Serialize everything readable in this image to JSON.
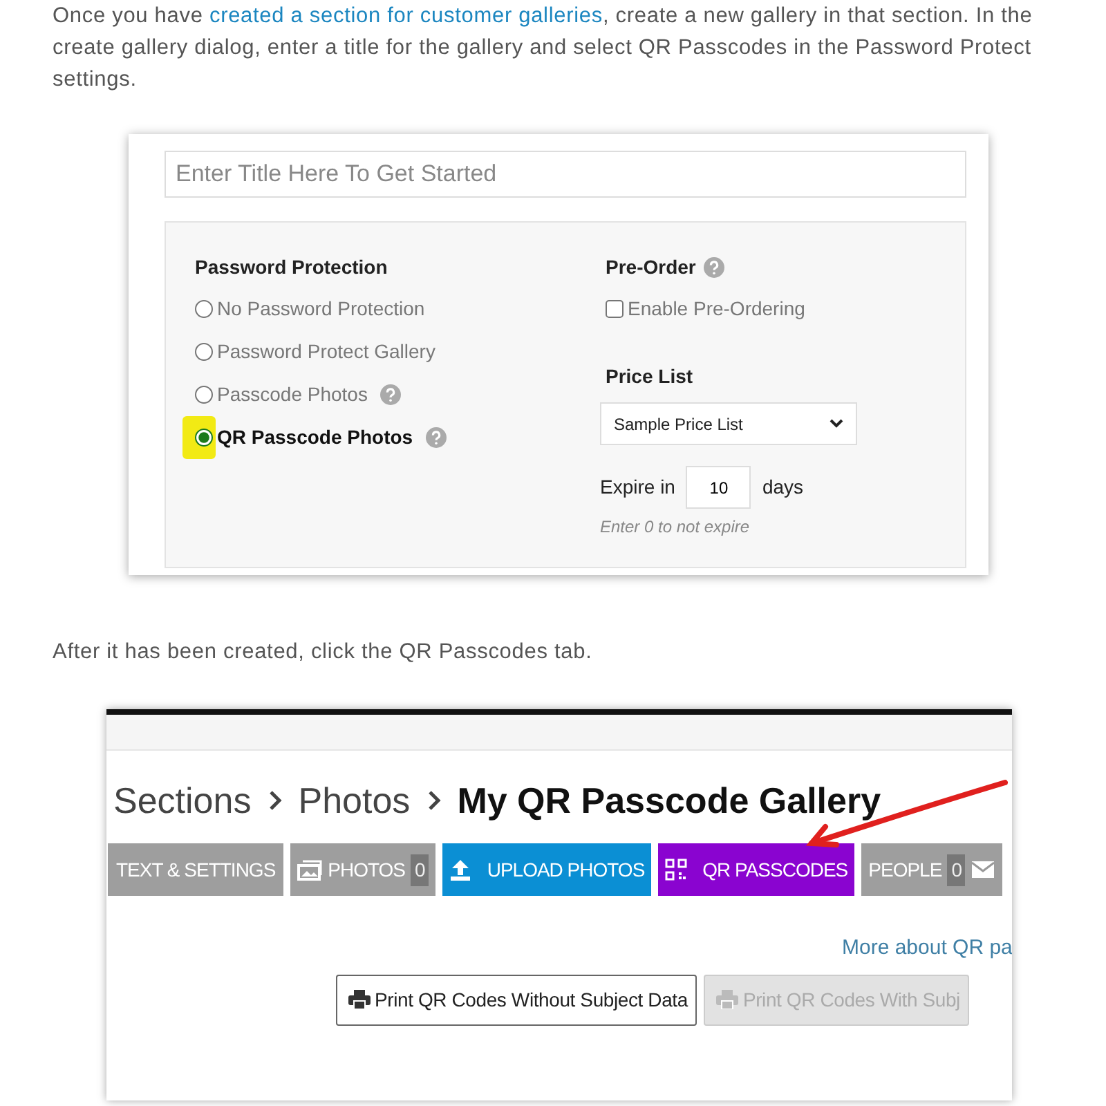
{
  "intro": {
    "before": "Once you have ",
    "link": "created a section for customer galleries",
    "after": ", create a new gallery in that section.  In the create gallery dialog, enter a title for the gallery and select QR Passcodes in the Password Protect settings."
  },
  "dialog": {
    "title_field": {
      "placeholder": "Enter Title Here To Get Started"
    },
    "password_protection": {
      "heading": "Password Protection",
      "options": [
        {
          "label": "No Password Protection",
          "selected": false,
          "help": false,
          "highlighted": false
        },
        {
          "label": "Password Protect Gallery",
          "selected": false,
          "help": false,
          "highlighted": false
        },
        {
          "label": "Passcode Photos",
          "selected": false,
          "help": true,
          "highlighted": false
        },
        {
          "label": "QR Passcode Photos",
          "selected": true,
          "help": true,
          "highlighted": true
        }
      ]
    },
    "preorder": {
      "heading": "Pre-Order",
      "checkbox": {
        "label": "Enable Pre-Ordering",
        "checked": false
      }
    },
    "price_list": {
      "heading": "Price List",
      "value": "Sample Price List"
    },
    "expire": {
      "label": "Expire in",
      "value": "10",
      "unit": "days",
      "hint": "Enter 0 to not expire"
    }
  },
  "step2": "After it has been created, click the QR Passcodes tab.",
  "gallery": {
    "breadcrumb": [
      {
        "label": "Sections",
        "current": false
      },
      {
        "label": "Photos",
        "current": false
      },
      {
        "label": "My QR Passcode Gallery",
        "current": true
      }
    ],
    "tabs": [
      {
        "label": "TEXT & SETTINGS",
        "kind": "plain",
        "color": "#9e9e9e"
      },
      {
        "label": "PHOTOS",
        "kind": "photos",
        "count": "0",
        "color": "#9e9e9e"
      },
      {
        "label": "UPLOAD PHOTOS",
        "kind": "upload",
        "color": "#0b8fd4"
      },
      {
        "label": "QR PASSCODES",
        "kind": "qr",
        "color": "#8a04d0"
      },
      {
        "label": "PEOPLE",
        "kind": "people",
        "count": "0",
        "color": "#9e9e9e"
      }
    ],
    "more_link": "More about QR pa",
    "buttons": [
      {
        "label": "Print QR Codes Without Subject Data",
        "disabled": false
      },
      {
        "label": "Print QR Codes With Subj",
        "disabled": true
      }
    ]
  }
}
